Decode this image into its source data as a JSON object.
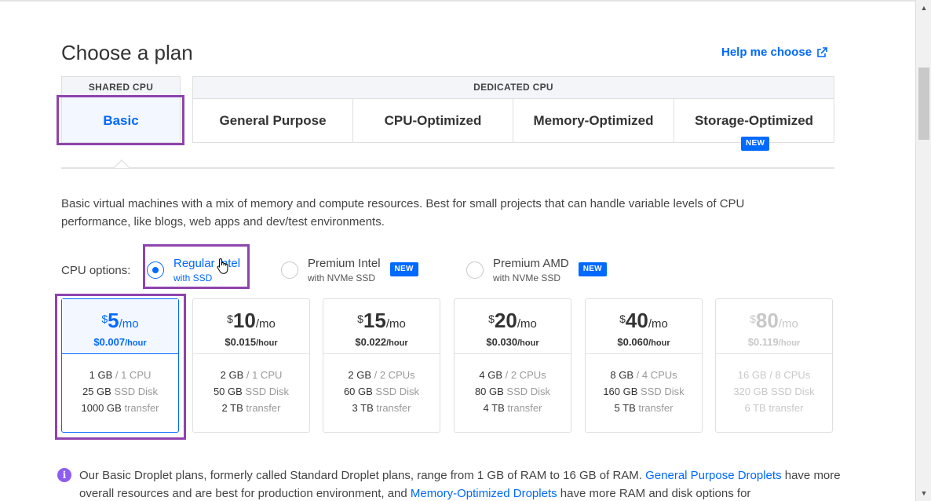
{
  "page": {
    "title": "Choose a plan",
    "help_link": "Help me choose"
  },
  "tabs": {
    "shared_header": "SHARED CPU",
    "dedicated_header": "DEDICATED CPU",
    "items": [
      {
        "label": "Basic",
        "selected": true
      },
      {
        "label": "General Purpose"
      },
      {
        "label": "CPU-Optimized"
      },
      {
        "label": "Memory-Optimized"
      },
      {
        "label": "Storage-Optimized",
        "badge": "NEW"
      }
    ]
  },
  "description": "Basic virtual machines with a mix of memory and compute resources. Best for small projects that can handle variable levels of CPU performance, like blogs, web apps and dev/test environments.",
  "cpu_options": {
    "label": "CPU options:",
    "options": [
      {
        "main": "Regular Intel",
        "sub": "with SSD",
        "selected": true
      },
      {
        "main": "Premium Intel",
        "sub": "with NVMe SSD",
        "badge": "NEW"
      },
      {
        "main": "Premium AMD",
        "sub": "with NVMe SSD",
        "badge": "NEW"
      }
    ]
  },
  "plans": [
    {
      "currency": "$",
      "amount": "5",
      "per": "/mo",
      "hourly": "$0.007",
      "hour_unit": "/hour",
      "mem": "1 GB",
      "cpu": "/ 1 CPU",
      "disk": "25 GB",
      "disk_label": "SSD Disk",
      "transfer": "1000 GB",
      "transfer_label": "transfer",
      "selected": true
    },
    {
      "currency": "$",
      "amount": "10",
      "per": "/mo",
      "hourly": "$0.015",
      "hour_unit": "/hour",
      "mem": "2 GB",
      "cpu": "/ 1 CPU",
      "disk": "50 GB",
      "disk_label": "SSD Disk",
      "transfer": "2 TB",
      "transfer_label": "transfer"
    },
    {
      "currency": "$",
      "amount": "15",
      "per": "/mo",
      "hourly": "$0.022",
      "hour_unit": "/hour",
      "mem": "2 GB",
      "cpu": "/ 2 CPUs",
      "disk": "60 GB",
      "disk_label": "SSD Disk",
      "transfer": "3 TB",
      "transfer_label": "transfer"
    },
    {
      "currency": "$",
      "amount": "20",
      "per": "/mo",
      "hourly": "$0.030",
      "hour_unit": "/hour",
      "mem": "4 GB",
      "cpu": "/ 2 CPUs",
      "disk": "80 GB",
      "disk_label": "SSD Disk",
      "transfer": "4 TB",
      "transfer_label": "transfer"
    },
    {
      "currency": "$",
      "amount": "40",
      "per": "/mo",
      "hourly": "$0.060",
      "hour_unit": "/hour",
      "mem": "8 GB",
      "cpu": "/ 4 CPUs",
      "disk": "160 GB",
      "disk_label": "SSD Disk",
      "transfer": "5 TB",
      "transfer_label": "transfer"
    },
    {
      "currency": "$",
      "amount": "80",
      "per": "/mo",
      "hourly": "$0.119",
      "hour_unit": "/hour",
      "mem": "16 GB",
      "cpu": "/ 8 CPUs",
      "disk": "320 GB",
      "disk_label": "SSD Disk",
      "transfer": "6 TB",
      "transfer_label": "transfer",
      "disabled": true
    }
  ],
  "info": {
    "text1": "Our Basic Droplet plans, formerly called Standard Droplet plans, range from 1 GB of RAM to 16 GB of RAM. ",
    "link1": "General Purpose Droplets",
    "text2": " have more overall resources and are best for production environment, and ",
    "link2": "Memory-Optimized Droplets",
    "text3": " have more RAM and disk options for"
  },
  "colors": {
    "accent": "#0069ff",
    "highlight": "#8e44ad",
    "info_icon": "#8e5cf0"
  }
}
